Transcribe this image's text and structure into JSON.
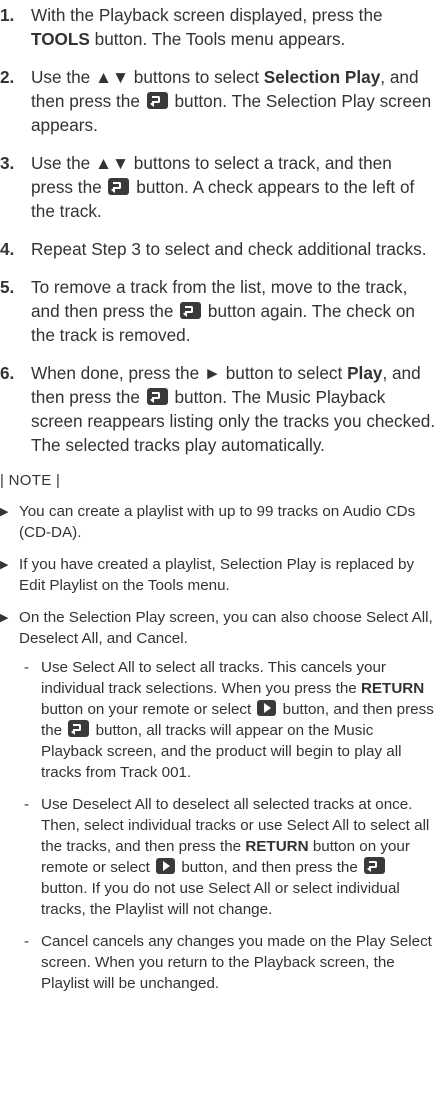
{
  "steps": [
    {
      "num": "1.",
      "t1": "With the Playback screen displayed, press the ",
      "b1": "TOOLS",
      "t2": " button. The Tools menu appears."
    },
    {
      "num": "2.",
      "t1": "Use the ▲▼ buttons to select ",
      "b1": "Selection Play",
      "t2": ", and then press the ",
      "t3": " button. The Selection Play screen appears."
    },
    {
      "num": "3.",
      "t1": "Use the ▲▼ buttons to select a track, and then press the ",
      "t2": " button. A check appears to the left of the track."
    },
    {
      "num": "4.",
      "t1": "Repeat Step 3 to select and check additional tracks."
    },
    {
      "num": "5.",
      "t1": "To remove a track from the list, move to the track, and then press the ",
      "t2": " button again. The check on the track is removed."
    },
    {
      "num": "6.",
      "t1": "When done, press the ► button to select ",
      "b1": "Play",
      "t2": ", and then press the ",
      "t3": " button. The Music Playback screen reappears listing only the tracks you checked. The selected tracks play automatically."
    }
  ],
  "note": {
    "label": "| NOTE |",
    "bullet": "▶",
    "items": [
      "You can create a playlist with up to 99 tracks on Audio CDs (CD-DA).",
      "If you have created a playlist, Selection Play is replaced by Edit Playlist on the Tools menu.",
      "On the Selection Play screen, you can also choose Select All, Deselect All, and Cancel."
    ],
    "sub_items": [
      {
        "dash": "-",
        "t1": "Use Select All to select all tracks. This cancels your individual track selections. When you press the ",
        "b1": "RETURN",
        "t2": " button on your remote or select ",
        "t3": " button, and then press the ",
        "t4": " button, all tracks will appear on the Music Playback screen, and the product will begin to play all tracks from Track 001."
      },
      {
        "dash": "-",
        "t1": "Use Deselect All to deselect all selected tracks at once. Then, select individual tracks or use Select All to select all the tracks, and then press the ",
        "b1": "RETURN",
        "t2": " button on your remote or select ",
        "t3": " button, and then press the ",
        "t4": " button. If you do not use Select All or select individual tracks, the Playlist will not change."
      },
      {
        "dash": "-",
        "t1": "Cancel cancels any changes you made on the Play Select screen. When you return to the Playback screen, the Playlist will be unchanged."
      }
    ]
  }
}
